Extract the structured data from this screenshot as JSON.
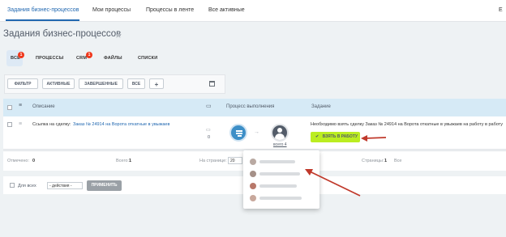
{
  "topnav": {
    "items": [
      "Задания бизнес-процессов",
      "Мои процессы",
      "Процессы в ленте",
      "Все активные"
    ],
    "right_label": "Е"
  },
  "page": {
    "title": "Задания бизнес-процессов",
    "star_icon": "star-icon"
  },
  "tabs": [
    {
      "label": "ВСЕ",
      "counter": "1"
    },
    {
      "label": "ПРОЦЕССЫ"
    },
    {
      "label": "CRM",
      "counter": "1"
    },
    {
      "label": "ФАЙЛЫ"
    },
    {
      "label": "СПИСКИ"
    }
  ],
  "toolbar": {
    "filter": "ФИЛЬТР",
    "active": "АКТИВНЫЕ",
    "completed": "ЗАВЕРШЕННЫЕ",
    "all": "ВСЕ",
    "add": "+"
  },
  "table": {
    "headers": {
      "description": "Описание",
      "progress": "Процесс выполнения",
      "task": "Задание"
    },
    "row": {
      "link_prefix": "Ссылка на сделку:",
      "link_text": "Заказ № 24914 на Ворота откатные в увыжаев",
      "comments": "0",
      "total": "всего 4",
      "task_text": "Необходимо взять сделку Заказ № 24914 на Ворота откатные в увыжаев на работу в работу",
      "take_button": "ВЗЯТЬ В РАБОТУ"
    }
  },
  "footer": {
    "marked_label": "Отмечено:",
    "marked_value": "0",
    "total_label": "Всего:",
    "total_value": "1",
    "per_page_label": "На странице:",
    "per_page_value": "20",
    "pages_label": "Страницы:",
    "pages_value": "1",
    "all_link": "Все"
  },
  "actions": {
    "for_all": "Для всех",
    "action_select": "- действия -",
    "apply": "ПРИМЕНИТЬ"
  },
  "colors": {
    "accent": "#2067b0",
    "take_button": "#bbed21",
    "arrow": "#c0392b",
    "counter": "#f0371b"
  }
}
